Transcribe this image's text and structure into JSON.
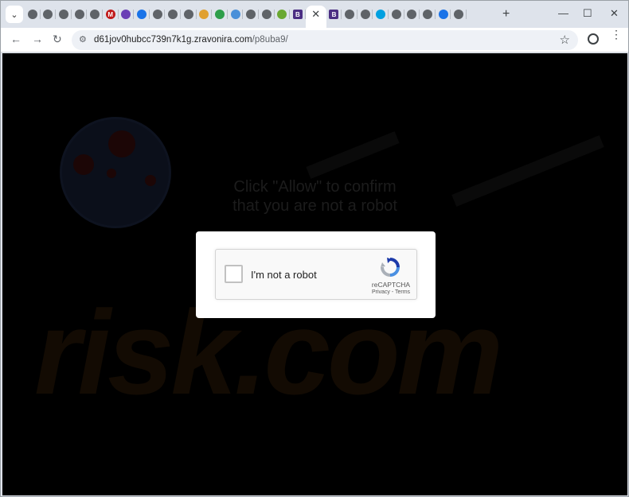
{
  "browser": {
    "tab_search_icon": "chevron-down-icon",
    "tabs": [
      {
        "icon": "globe-search-icon",
        "color": "#5f6368"
      },
      {
        "icon": "globe-icon",
        "color": "#5f6368"
      },
      {
        "icon": "globe-icon",
        "color": "#5f6368"
      },
      {
        "icon": "globe-icon",
        "color": "#5f6368"
      },
      {
        "icon": "globe-icon",
        "color": "#5f6368"
      },
      {
        "icon": "mcafee-shield-icon",
        "color": "#c01818"
      },
      {
        "icon": "purple-bolt-icon",
        "color": "#6a3fb5"
      },
      {
        "icon": "target-icon",
        "color": "#1a73e8"
      },
      {
        "icon": "globe-icon",
        "color": "#5f6368"
      },
      {
        "icon": "globe-icon",
        "color": "#5f6368"
      },
      {
        "icon": "globe-icon",
        "color": "#5f6368"
      },
      {
        "icon": "hand-pointer-icon",
        "color": "#e0a030"
      },
      {
        "icon": "download-icon",
        "color": "#2e9e4a"
      },
      {
        "icon": "shield-check-icon",
        "color": "#4a90d9"
      },
      {
        "icon": "globe-icon",
        "color": "#5f6368"
      },
      {
        "icon": "globe-icon",
        "color": "#5f6368"
      },
      {
        "icon": "plant-icon",
        "color": "#6aa832"
      },
      {
        "icon": "b-letter-icon",
        "color": "#4b2e83"
      },
      {
        "icon": "close-icon",
        "color": "#3c4043",
        "active": true
      },
      {
        "icon": "b-letter-icon",
        "color": "#4b2e83"
      },
      {
        "icon": "globe-icon",
        "color": "#5f6368"
      },
      {
        "icon": "globe-icon",
        "color": "#5f6368"
      },
      {
        "icon": "cube-icon",
        "color": "#00a0e0"
      },
      {
        "icon": "globe-icon",
        "color": "#5f6368"
      },
      {
        "icon": "globe-icon",
        "color": "#5f6368"
      },
      {
        "icon": "page-icon",
        "color": "#5f6368"
      },
      {
        "icon": "chrome-icon",
        "color": "#1a73e8"
      },
      {
        "icon": "globe-icon",
        "color": "#5f6368"
      }
    ],
    "new_tab_label": "+",
    "minimize_label": "—",
    "maximize_label": "☐",
    "close_label": "✕",
    "back_label": "←",
    "forward_label": "→",
    "reload_label": "↻",
    "url_host": "d61jov0hubcc739n7k1g.zravonira.com",
    "url_path": "/p8uba9/",
    "bookmark_label": "☆",
    "menu_label": "⋮"
  },
  "page": {
    "message_line1": "Click \"Allow\" to confirm",
    "message_line2": "that you are not a robot",
    "watermark_text": "risk.com",
    "captcha": {
      "label": "I'm not a robot",
      "brand": "reCAPTCHA",
      "links": "Privacy - Terms"
    }
  }
}
